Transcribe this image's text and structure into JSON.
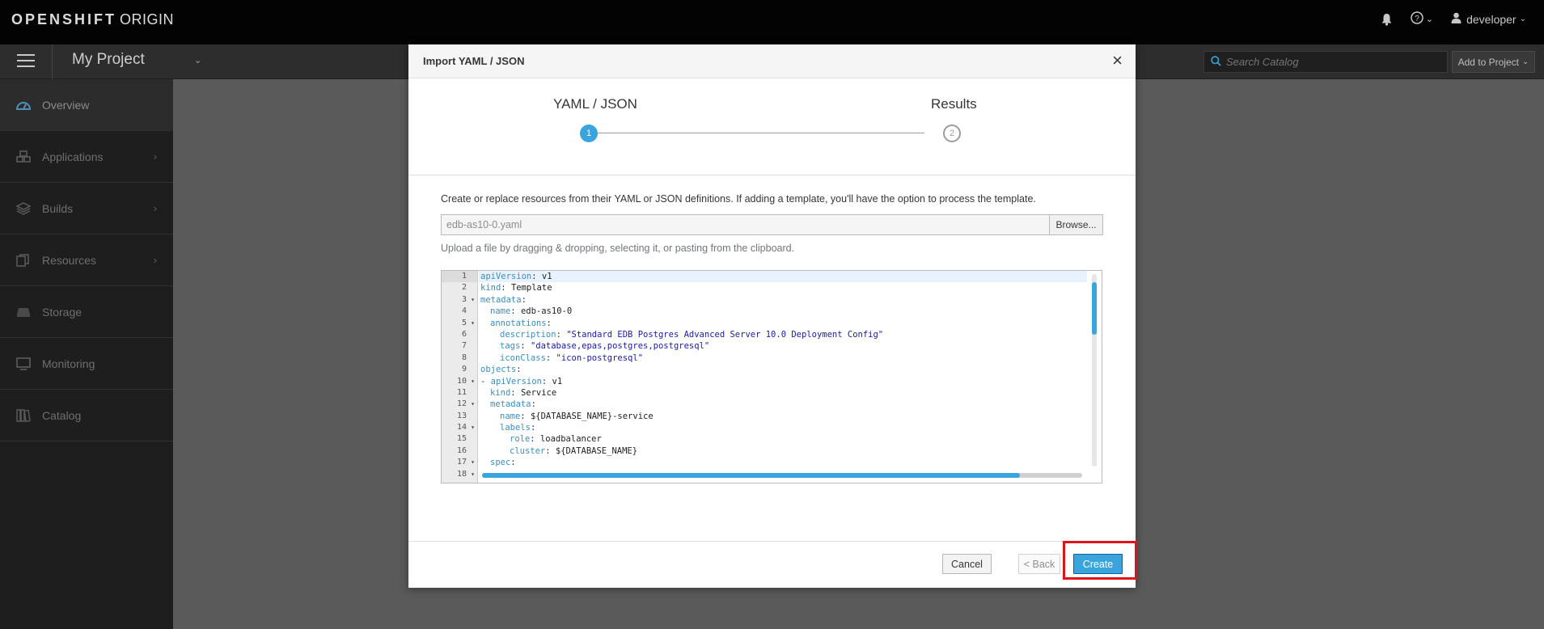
{
  "topbar": {
    "brand_main": "OPENSHIFT",
    "brand_sub": "ORIGIN",
    "help_caret": "⌄",
    "user": "developer"
  },
  "subbar": {
    "project": "My Project",
    "search_placeholder": "Search Catalog",
    "add_to_project": "Add to Project"
  },
  "sidebar": {
    "items": [
      {
        "label": "Overview",
        "icon": "dashboard-icon",
        "active": true,
        "chevron": false
      },
      {
        "label": "Applications",
        "icon": "cubes-icon",
        "chevron": true
      },
      {
        "label": "Builds",
        "icon": "layers-icon",
        "chevron": true
      },
      {
        "label": "Resources",
        "icon": "files-icon",
        "chevron": true
      },
      {
        "label": "Storage",
        "icon": "storage-icon",
        "chevron": false
      },
      {
        "label": "Monitoring",
        "icon": "monitor-icon",
        "chevron": false
      },
      {
        "label": "Catalog",
        "icon": "book-icon",
        "chevron": false
      }
    ]
  },
  "modal": {
    "title": "Import YAML / JSON",
    "close": "×",
    "steps": [
      {
        "label": "YAML / JSON",
        "number": "1",
        "active": true
      },
      {
        "label": "Results",
        "number": "2",
        "active": false
      }
    ],
    "description": "Create or replace resources from their YAML or JSON definitions. If adding a template, you'll have the option to process the template.",
    "file_value": "edb-as10-0.yaml",
    "browse_label": "Browse...",
    "hint": "Upload a file by dragging & dropping, selecting it, or pasting from the clipboard.",
    "footer": {
      "cancel": "Cancel",
      "back": "< Back",
      "create": "Create"
    }
  },
  "editor": {
    "lines": [
      {
        "n": "1",
        "fold": "",
        "key": "apiVersion",
        "val": " v1",
        "str": false,
        "indent": 0
      },
      {
        "n": "2",
        "fold": "",
        "key": "kind",
        "val": " Template",
        "str": false,
        "indent": 0
      },
      {
        "n": "3",
        "fold": "▾",
        "key": "metadata",
        "val": "",
        "str": false,
        "indent": 0
      },
      {
        "n": "4",
        "fold": "",
        "key": "name",
        "val": " edb-as10-0",
        "str": false,
        "indent": 1
      },
      {
        "n": "5",
        "fold": "▾",
        "key": "annotations",
        "val": "",
        "str": false,
        "indent": 1
      },
      {
        "n": "6",
        "fold": "",
        "key": "description",
        "val": " \"Standard EDB Postgres Advanced Server 10.0 Deployment Config\"",
        "str": true,
        "indent": 2
      },
      {
        "n": "7",
        "fold": "",
        "key": "tags",
        "val": " \"database,epas,postgres,postgresql\"",
        "str": true,
        "indent": 2
      },
      {
        "n": "8",
        "fold": "",
        "key": "iconClass",
        "val": " \"icon-postgresql\"",
        "str": true,
        "indent": 2
      },
      {
        "n": "9",
        "fold": "",
        "key": "objects",
        "val": "",
        "str": false,
        "indent": 0
      },
      {
        "n": "10",
        "fold": "▾",
        "key": "apiVersion",
        "val": " v1",
        "str": false,
        "indent": 0,
        "dash": true
      },
      {
        "n": "11",
        "fold": "",
        "key": "kind",
        "val": " Service",
        "str": false,
        "indent": 1
      },
      {
        "n": "12",
        "fold": "▾",
        "key": "metadata",
        "val": "",
        "str": false,
        "indent": 1
      },
      {
        "n": "13",
        "fold": "",
        "key": "name",
        "val": " ${DATABASE_NAME}-service",
        "str": false,
        "indent": 2
      },
      {
        "n": "14",
        "fold": "▾",
        "key": "labels",
        "val": "",
        "str": false,
        "indent": 2
      },
      {
        "n": "15",
        "fold": "",
        "key": "role",
        "val": " loadbalancer",
        "str": false,
        "indent": 3
      },
      {
        "n": "16",
        "fold": "",
        "key": "cluster",
        "val": " ${DATABASE_NAME}",
        "str": false,
        "indent": 3
      },
      {
        "n": "17",
        "fold": "▾",
        "key": "spec",
        "val": "",
        "str": false,
        "indent": 1
      },
      {
        "n": "18",
        "fold": "▾",
        "key": "",
        "val": "",
        "str": false,
        "indent": 0
      }
    ]
  },
  "colors": {
    "accent": "#39a5dc",
    "highlight": "#e0131c"
  }
}
